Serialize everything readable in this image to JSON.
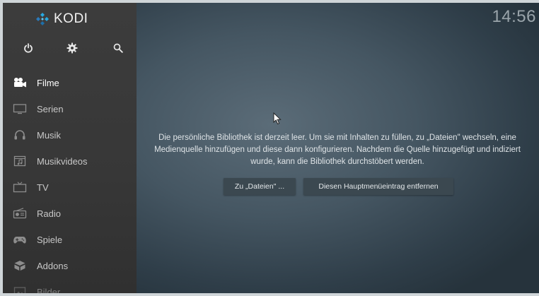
{
  "app": {
    "logo_text": "KODI",
    "clock": "14:56"
  },
  "toolbar": {
    "icons": [
      "power-icon",
      "gear-icon",
      "search-icon"
    ]
  },
  "menu": {
    "items": [
      {
        "label": "Filme",
        "icon": "movie-camera-icon"
      },
      {
        "label": "Serien",
        "icon": "tv-screen-icon"
      },
      {
        "label": "Musik",
        "icon": "headphones-icon"
      },
      {
        "label": "Musikvideos",
        "icon": "music-video-icon"
      },
      {
        "label": "TV",
        "icon": "television-icon"
      },
      {
        "label": "Radio",
        "icon": "radio-icon"
      },
      {
        "label": "Spiele",
        "icon": "gamepad-icon"
      },
      {
        "label": "Addons",
        "icon": "addons-box-icon"
      },
      {
        "label": "Bilder",
        "icon": "image-icon"
      }
    ]
  },
  "main": {
    "message": "Die persönliche Bibliothek ist derzeit leer. Um sie mit Inhalten zu füllen, zu „Dateien\" wechseln, eine Medienquelle hinzufügen und diese dann konfigurieren. Nachdem die Quelle hinzugefügt und indiziert wurde, kann die Bibliothek durchstöbert werden.",
    "btn_files": "Zu „Dateien\" ...",
    "btn_remove": "Diesen Hauptmenüeintrag entfernen"
  },
  "colors": {
    "sidebar_bg": "#3a3a3a",
    "main_bg": "#455662",
    "button_bg": "#3b4850",
    "kodi_blue": "#27a9e1",
    "text_primary": "#ffffff"
  }
}
